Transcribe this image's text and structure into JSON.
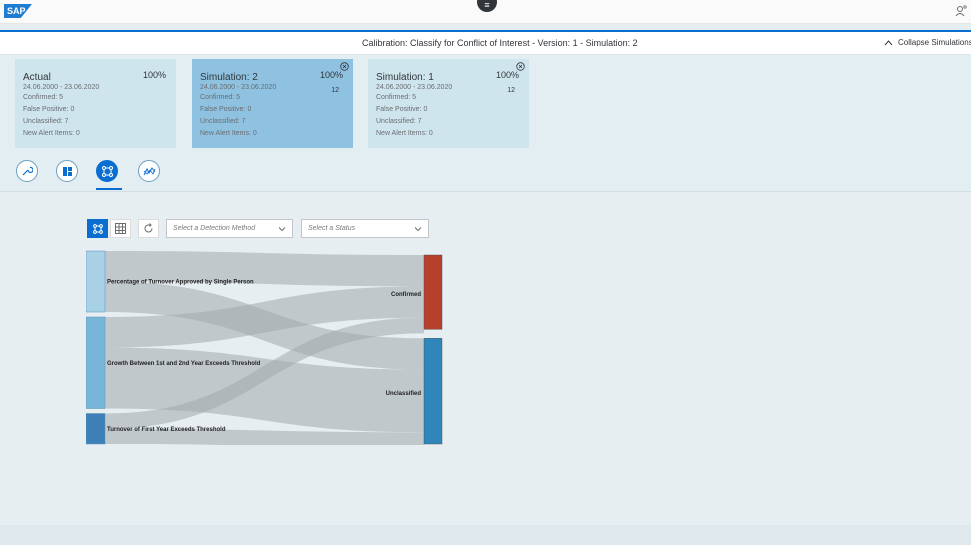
{
  "shell": {
    "logo_text": "SAP"
  },
  "title_bar": {
    "title": "Calibration: Classify for Conflict of Interest - Version: 1 - Simulation: 2",
    "collapse_label": "Collapse Simulations"
  },
  "cards": [
    {
      "title": "Actual",
      "percent": "100%",
      "count": "",
      "date_range": "24.06.2000 - 23.06.2020",
      "lines": [
        "Confirmed: 5",
        "False Positive: 0",
        "Unclassified: 7",
        "New Alert Items: 0"
      ],
      "closable": false,
      "active": false
    },
    {
      "title": "Simulation: 2",
      "percent": "100%",
      "count": "12",
      "date_range": "24.06.2000 - 23.06.2020",
      "lines": [
        "Confirmed: 5",
        "False Positive: 0",
        "Unclassified: 7",
        "New Alert Items: 0"
      ],
      "closable": true,
      "active": true
    },
    {
      "title": "Simulation: 1",
      "percent": "100%",
      "count": "12",
      "date_range": "24.06.2000 - 23.06.2020",
      "lines": [
        "Confirmed: 5",
        "False Positive: 0",
        "Unclassified: 7",
        "New Alert Items: 0"
      ],
      "closable": true,
      "active": false
    }
  ],
  "icon_tabs": [
    "wrench-icon",
    "dashboard-icon",
    "sankey-network-icon",
    "trend-chart-icon"
  ],
  "filters": {
    "detection_method_placeholder": "Select a Detection Method",
    "status_placeholder": "Select a Status"
  },
  "sankey": {
    "sources": [
      {
        "label": "Percentage of Turnover Approved by Single Person",
        "value": 4
      },
      {
        "label": "Growth Between 1st and 2nd Year Exceeds Threshold",
        "value": 6
      },
      {
        "label": "Turnover of First Year Exceeds Threshold",
        "value": 2
      }
    ],
    "targets": [
      {
        "label": "Confirmed",
        "value": 5
      },
      {
        "label": "Unclassified",
        "value": 7
      }
    ],
    "links": [
      {
        "source": 0,
        "target": 0,
        "value": 2
      },
      {
        "source": 0,
        "target": 1,
        "value": 2
      },
      {
        "source": 1,
        "target": 0,
        "value": 2
      },
      {
        "source": 1,
        "target": 1,
        "value": 4
      },
      {
        "source": 2,
        "target": 0,
        "value": 1
      },
      {
        "source": 2,
        "target": 1,
        "value": 1
      }
    ],
    "colors": {
      "source_a": "#a9d1e6",
      "source_b": "#79b5d9",
      "source_c": "#3f7fb7",
      "confirmed": "#b6402c",
      "unclassified": "#2f86bb",
      "link": "#a3a9ad"
    }
  }
}
